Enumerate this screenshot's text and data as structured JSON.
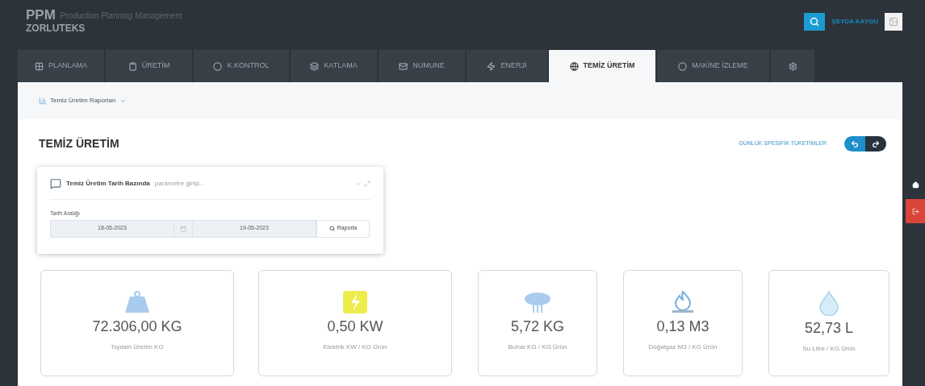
{
  "header": {
    "brand": "PPM",
    "subtitle": "Production Planning Management",
    "company": "ZORLUTEKS",
    "user": "ŞEYDA KAYGU"
  },
  "tabs": [
    {
      "label": "PLANLAMA",
      "selected": false
    },
    {
      "label": "ÜRETİM",
      "selected": false
    },
    {
      "label": "K.KONTROL",
      "selected": false
    },
    {
      "label": "KATLAMA",
      "selected": false
    },
    {
      "label": "NUMUNE",
      "selected": false
    },
    {
      "label": "ENERJİ",
      "selected": false
    },
    {
      "label": "TEMİZ ÜRETİM",
      "selected": true
    },
    {
      "label": "MAKİNE İZLEME",
      "selected": false
    },
    {
      "selected": false
    }
  ],
  "subnav": {
    "label": "Temiz Üretim Raporları"
  },
  "page_title": "TEMİZ ÜRETİM",
  "report_link": "GÜNLÜK SPESİFİK TÜKETİMLER",
  "filter": {
    "title": "Temiz Üretim Tarih Bazında",
    "hint": "parametre girişi...",
    "range_label": "Tarih Aralığı",
    "start": "18-05-2023",
    "end": "19-05-2023",
    "button": "Raporla"
  },
  "stats": [
    {
      "kind": "weight",
      "value": "72.306,00 KG",
      "label": "Toplam Üretim KG"
    },
    {
      "kind": "electric",
      "value": "0,50 KW",
      "label": "Elektrik KW / KG Ürün"
    },
    {
      "kind": "steam",
      "value": "5,72 KG",
      "label": "Buhar KG / KG Ürün"
    },
    {
      "kind": "gas",
      "value": "0,13 M3",
      "label": "Doğalgaz M3 / KG Ürün"
    },
    {
      "kind": "water",
      "value": "52,73 L",
      "label": "Su Litre / KG Ürün"
    }
  ]
}
